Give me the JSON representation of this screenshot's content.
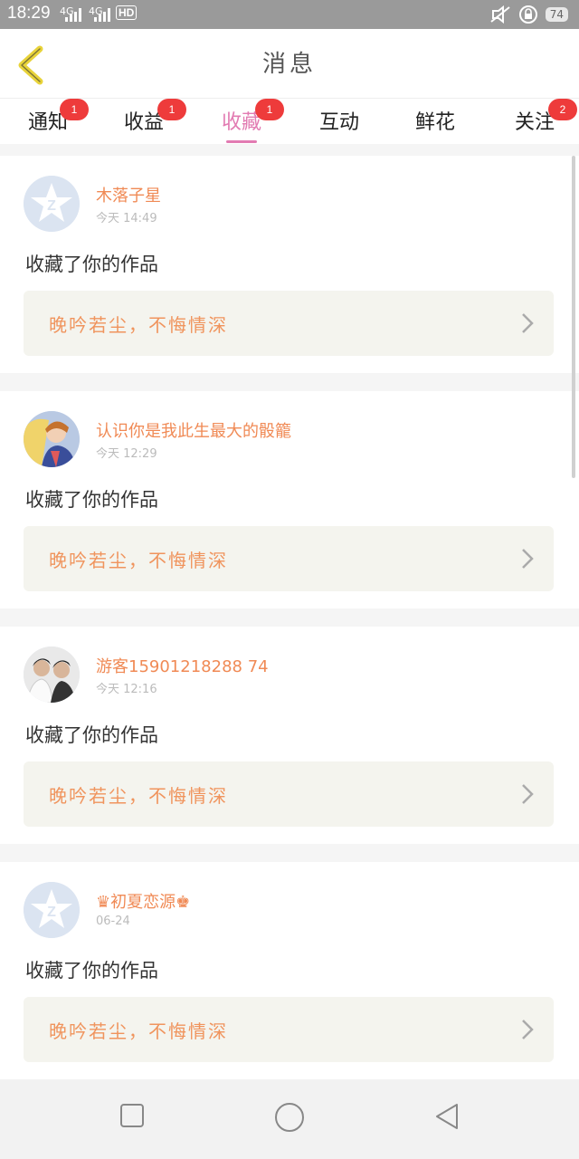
{
  "status_bar": {
    "time": "18:29",
    "network1": "4G",
    "network2": "4G",
    "hd": "HD",
    "battery": "74"
  },
  "header": {
    "title": "消息",
    "back_icon": "back-chevron-icon"
  },
  "tabs": [
    {
      "label": "通知",
      "badge": "1",
      "active": false
    },
    {
      "label": "收益",
      "badge": "1",
      "active": false
    },
    {
      "label": "收藏",
      "badge": "1",
      "active": true
    },
    {
      "label": "互动",
      "badge": "",
      "active": false
    },
    {
      "label": "鲜花",
      "badge": "",
      "active": false
    },
    {
      "label": "关注",
      "badge": "2",
      "active": false
    }
  ],
  "items": [
    {
      "name": "木落子星",
      "time": "今天 14:49",
      "action": "收藏了你的作品",
      "work_title": "晚吟若尘，不悔情深",
      "avatar": "default-avatar-icon"
    },
    {
      "name": "认识你是我此生最大的骰籠",
      "time": "今天 12:29",
      "action": "收藏了你的作品",
      "work_title": "晚吟若尘，不悔情深",
      "avatar": "anime-avatar-icon"
    },
    {
      "name": "游客15901218288 74",
      "time": "今天 12:16",
      "action": "收藏了你的作品",
      "work_title": "晚吟若尘，不悔情深",
      "avatar": "photo-avatar-icon"
    },
    {
      "name": "♛初夏恋源♚",
      "time": "06-24",
      "action": "收藏了你的作品",
      "work_title": "晚吟若尘，不悔情深",
      "avatar": "default-avatar-icon"
    }
  ],
  "colors": {
    "accent": "#e27bb2",
    "name": "#f08a55",
    "badge": "#ee3b3b"
  }
}
